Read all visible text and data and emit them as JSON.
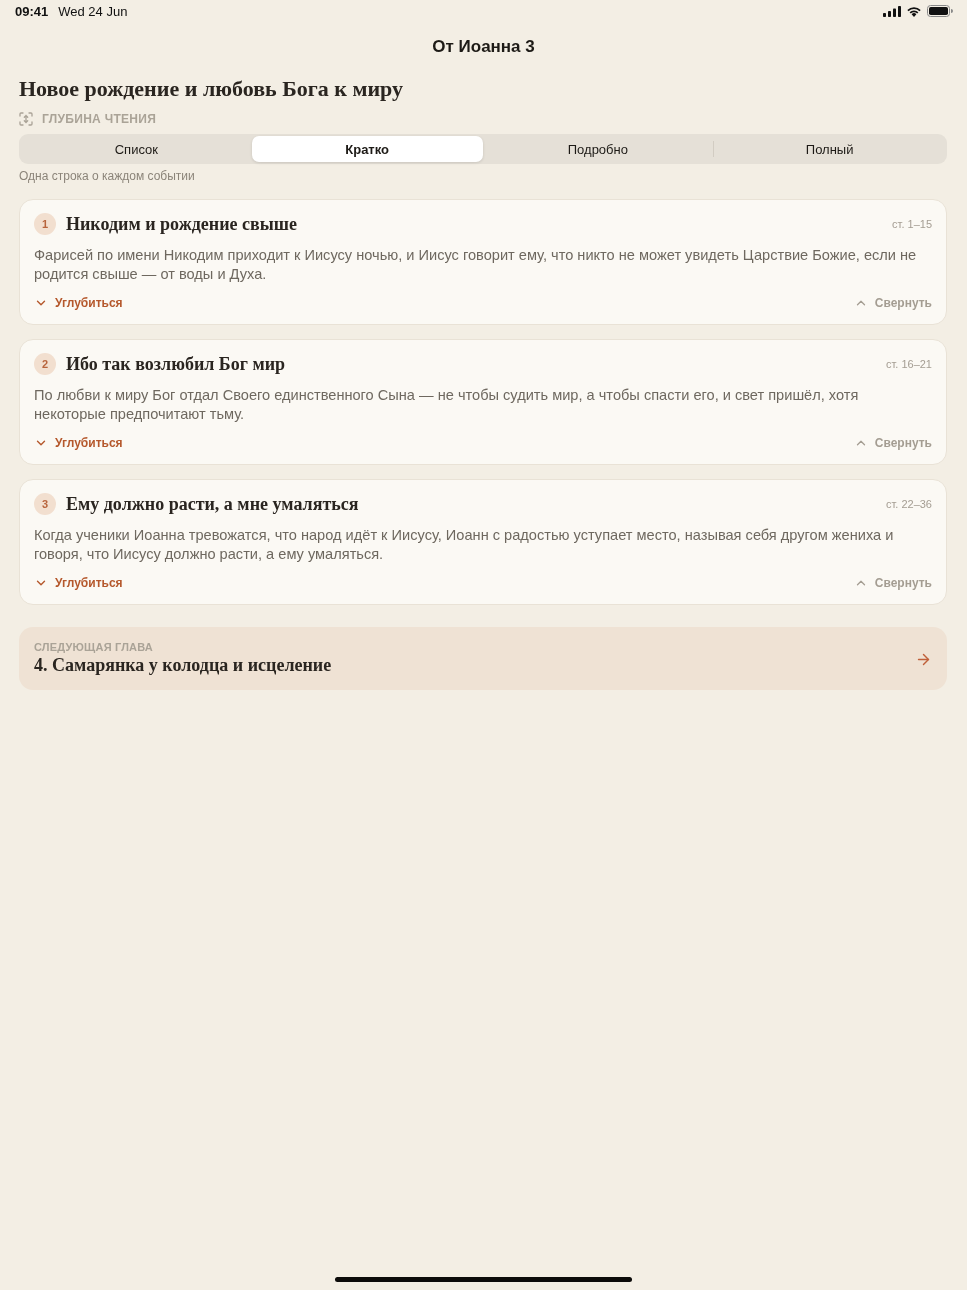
{
  "status_bar": {
    "time": "09:41",
    "date": "Wed 24 Jun"
  },
  "nav": {
    "title": "От Иоанна 3"
  },
  "heading": "Новое рождение и любовь Бога к миру",
  "depth": {
    "label": "ГЛУБИНА ЧТЕНИЯ",
    "tabs": [
      {
        "label": "Список",
        "selected": false
      },
      {
        "label": "Кратко",
        "selected": true
      },
      {
        "label": "Подробно",
        "selected": false
      },
      {
        "label": "Полный",
        "selected": false
      }
    ],
    "description": "Одна строка о каждом событии"
  },
  "events": [
    {
      "number": "1",
      "title": "Никодим и рождение свыше",
      "verses": "ст. 1–15",
      "summary": "Фарисей по имени Никодим приходит к Иисусу ночью, и Иисус говорит ему, что никто не может увидеть Царствие Божие, если не родится свыше — от воды и Духа.",
      "expand_label": "Углубиться",
      "collapse_label": "Свернуть"
    },
    {
      "number": "2",
      "title": "Ибо так возлюбил Бог мир",
      "verses": "ст. 16–21",
      "summary": "По любви к миру Бог отдал Своего единственного Сына — не чтобы судить мир, а чтобы спасти его, и свет пришёл, хотя некоторые предпочитают тьму.",
      "expand_label": "Углубиться",
      "collapse_label": "Свернуть"
    },
    {
      "number": "3",
      "title": "Ему должно расти, а мне умаляться",
      "verses": "ст. 22–36",
      "summary": "Когда ученики Иоанна тревожатся, что народ идёт к Иисусу, Иоанн с радостью уступает место, называя себя другом жениха и говоря, что Иисусу должно расти, а ему умаляться.",
      "expand_label": "Углубиться",
      "collapse_label": "Свернуть"
    }
  ],
  "next_chapter": {
    "label": "СЛЕДУЮЩАЯ ГЛАВА",
    "title": "4. Самарянка у колодца и исцеление"
  }
}
